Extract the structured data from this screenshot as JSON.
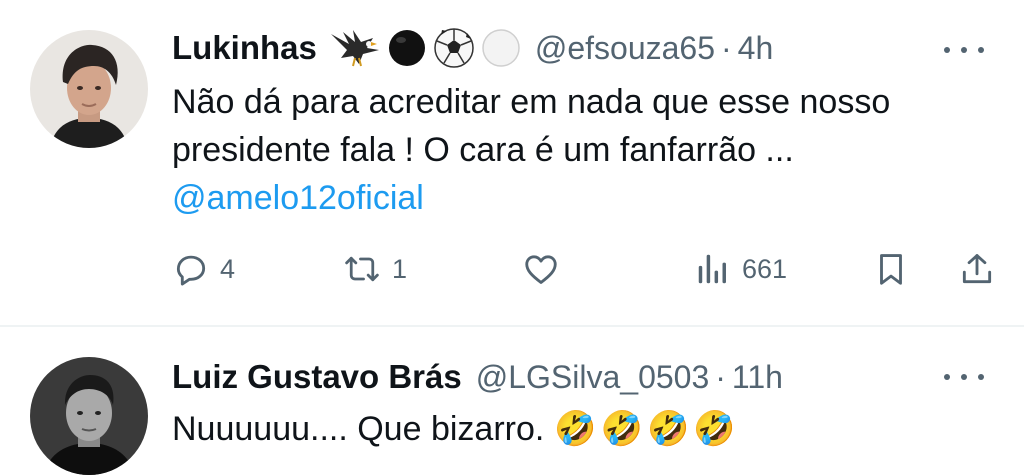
{
  "tweets": [
    {
      "name": "Lukinhas",
      "handle": "@efsouza65",
      "separator": "·",
      "time": "4h",
      "name_emojis": [
        "eagle-emoji",
        "black-circle-emoji",
        "soccer-ball-emoji",
        "white-circle-emoji"
      ],
      "text_line1": "Não dá para acreditar em nada que esse nosso",
      "text_line2": "presidente fala ! O cara é um fanfarrão ...",
      "mention": "@amelo12oficial",
      "actions": {
        "replies": "4",
        "retweets": "1",
        "likes": "",
        "views": "661"
      }
    },
    {
      "name": "Luiz Gustavo Brás",
      "handle": "@LGSilva_0503",
      "separator": "·",
      "time": "11h",
      "text": "Nuuuuuu.... Que bizarro.",
      "text_emojis": "🤣🤣🤣🤣"
    }
  ],
  "colors": {
    "text": "#0f1419",
    "secondary": "#536471",
    "link": "#1d9bf0",
    "divider": "#eff3f4"
  }
}
